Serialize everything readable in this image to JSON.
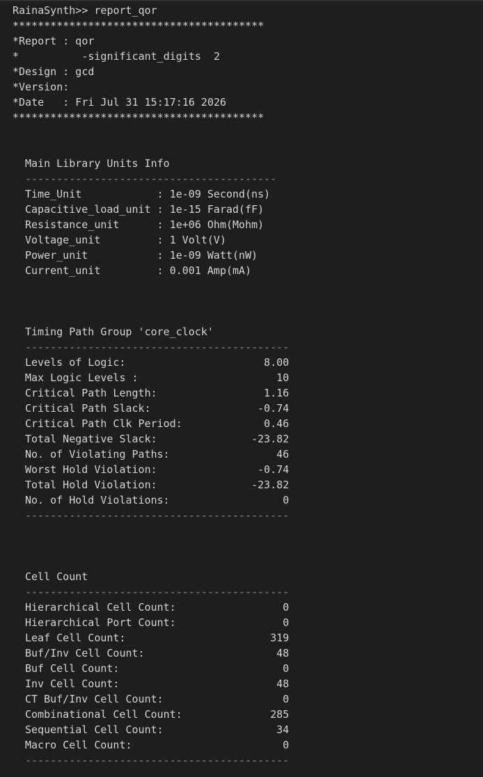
{
  "terminal": {
    "prompt": "RainaSynth>> report_qor",
    "star_line": "****************************************",
    "header": {
      "report": "*Report : qor",
      "sig_digits": "*          -significant_digits  2",
      "design": "*Design : gcd",
      "version": "*Version:",
      "date": "*Date   : Fri Jul 31 15:17:16 2026"
    }
  },
  "units": {
    "title": "Main Library Units Info",
    "sep": "----------------------------------------",
    "rows": [
      "Time_Unit            : 1e-09 Second(ns)",
      "Capacitive_load_unit : 1e-15 Farad(fF)",
      "Resistance_unit      : 1e+06 Ohm(Mohm)",
      "Voltage_unit         : 1 Volt(V)",
      "Power_unit           : 1e-09 Watt(nW)",
      "Current_unit         : 0.001 Amp(mA)"
    ]
  },
  "timing": {
    "title": "Timing Path Group 'core_clock'",
    "sep": "------------------------------------------",
    "rows": [
      "Levels of Logic:                      8.00",
      "Max Logic Levels :                      10",
      "Critical Path Length:                 1.16",
      "Critical Path Slack:                 -0.74",
      "Critical Path Clk Period:             0.46",
      "Total Negative Slack:               -23.82",
      "No. of Violating Paths:                 46",
      "Worst Hold Violation:                -0.74",
      "Total Hold Violation:               -23.82",
      "No. of Hold Violations:                  0"
    ]
  },
  "cells": {
    "title": "Cell Count",
    "sep": "------------------------------------------",
    "rows": [
      "Hierarchical Cell Count:                 0",
      "Hierarchical Port Count:                 0",
      "Leaf Cell Count:                       319",
      "Buf/Inv Cell Count:                     48",
      "Buf Cell Count:                          0",
      "Inv Cell Count:                         48",
      "CT Buf/Inv Cell Count:                   0",
      "Combinational Cell Count:              285",
      "Sequential Cell Count:                  34",
      "Macro Cell Count:                        0"
    ]
  }
}
